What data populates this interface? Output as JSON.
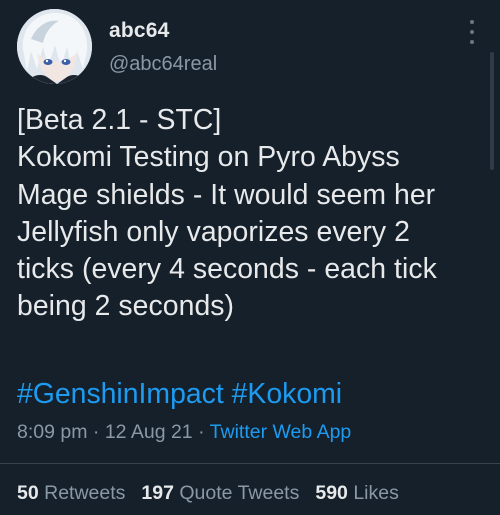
{
  "author": {
    "display_name": "abc64",
    "handle": "@abc64real",
    "avatar_icon": "anime-avatar-icon"
  },
  "more_icon": "more-vertical-icon",
  "tweet": {
    "text": "[Beta 2.1 - STC]\nKokomi Testing on Pyro Abyss\nMage shields - It would seem her\nJellyfish only vaporizes every 2\nticks (every 4 seconds - each tick\nbeing 2 seconds)",
    "hashtags": [
      "#GenshinImpact",
      "#Kokomi"
    ]
  },
  "meta": {
    "time": "8:09 pm",
    "separator": "·",
    "date": "12 Aug 21",
    "source": "Twitter Web App"
  },
  "stats": {
    "retweets_count": "50",
    "retweets_label": "Retweets",
    "quotes_count": "197",
    "quotes_label": "Quote Tweets",
    "likes_count": "590",
    "likes_label": "Likes"
  },
  "colors": {
    "background": "#15202b",
    "link": "#1d9bf0",
    "secondary_text": "#8b98a5",
    "primary_text": "#e7e9ea"
  }
}
